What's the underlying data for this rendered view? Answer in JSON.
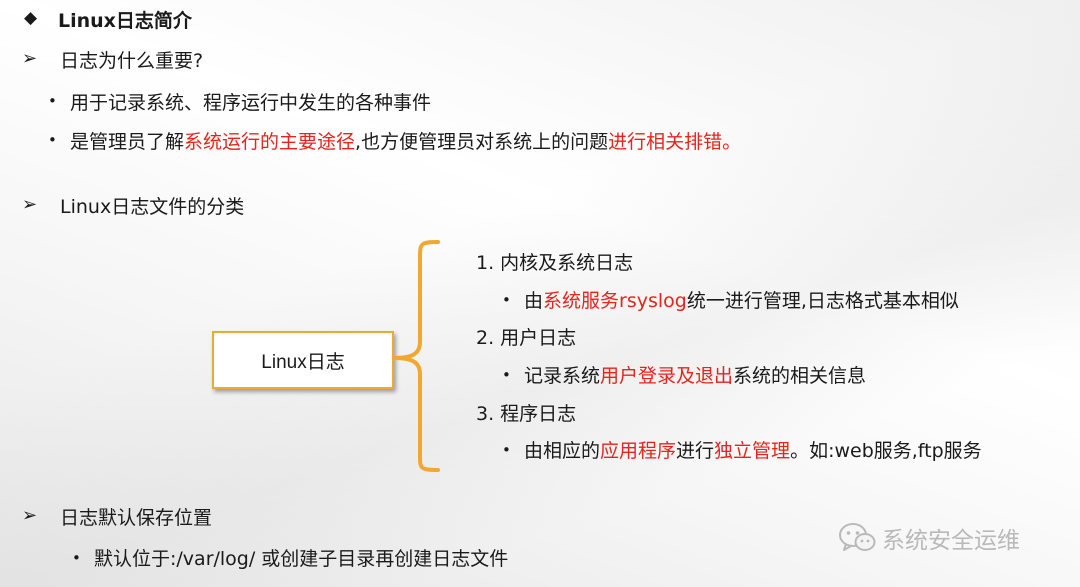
{
  "title": {
    "bullet": "◆",
    "text": "Linux日志简介"
  },
  "sections": [
    {
      "bullet": "➢",
      "heading": "日志为什么重要?",
      "items": [
        {
          "parts": [
            "用于记录系统、程序运行中发生的各种事件"
          ]
        },
        {
          "parts": [
            "是管理员了解",
            "系统运行的主要途径",
            ",也方便管理员对系统上的问题",
            "进行相关排错",
            "。"
          ]
        }
      ]
    },
    {
      "bullet": "➢",
      "heading": "Linux日志文件的分类"
    },
    {
      "bullet": "➢",
      "heading": "日志默认保存位置",
      "items": [
        {
          "parts": [
            "默认位于:/var/log/ 或创建子目录再创建日志文件"
          ]
        }
      ]
    }
  ],
  "diagram": {
    "box_label": "Linux日志",
    "categories": [
      {
        "label": "1.  内核及系统日志",
        "detail": [
          "由",
          "系统服务rsyslog",
          "统一进行管理,日志格式基本相似"
        ]
      },
      {
        "label": "2.  用户日志",
        "detail": [
          "记录系统",
          "用户登录及退出",
          "系统的相关信息"
        ]
      },
      {
        "label": "3.  程序日志",
        "detail": [
          "由相应的",
          "应用程序",
          "进行",
          "独立管理",
          "。如:web服务,ftp服务"
        ]
      }
    ]
  },
  "watermark": {
    "icon": "wechat-icon",
    "text": "系统安全运维"
  },
  "colors": {
    "highlight": "#e8231b",
    "brace": "#f0a830"
  }
}
